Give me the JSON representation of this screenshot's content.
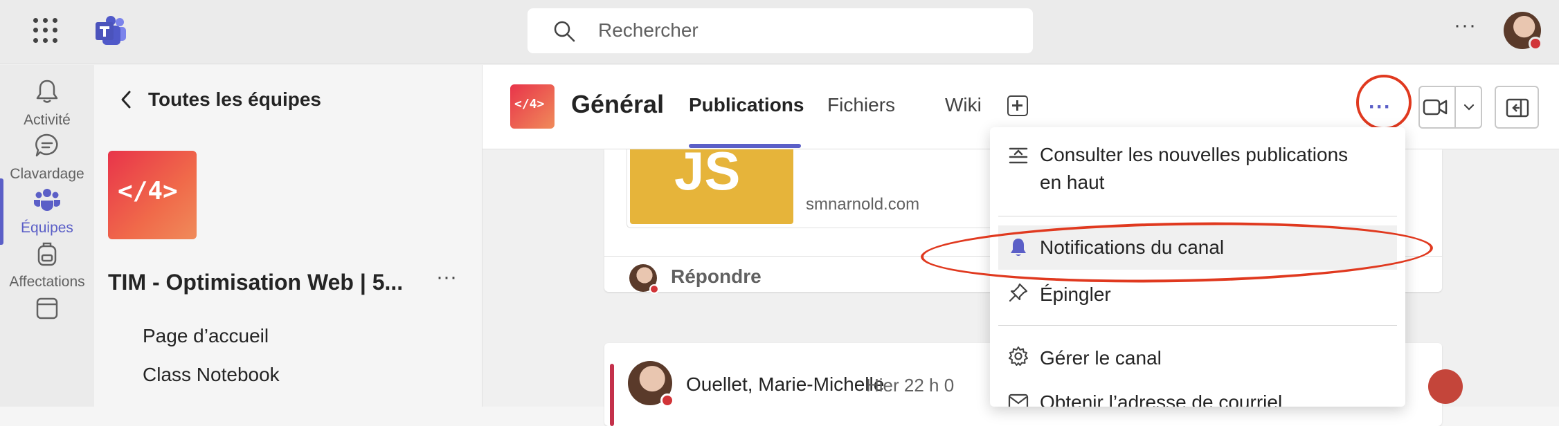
{
  "search": {
    "placeholder": "Rechercher"
  },
  "rail": {
    "items": [
      {
        "label": "Activité",
        "icon": "bell-icon"
      },
      {
        "label": "Clavardage",
        "icon": "chat-icon"
      },
      {
        "label": "Équipes",
        "icon": "teams-icon",
        "active": true
      },
      {
        "label": "Affectations",
        "icon": "backpack-icon"
      }
    ]
  },
  "sidebar": {
    "back_label": "Toutes les équipes",
    "team_tile_text": "</4>",
    "team_name": "TIM - Optimisation Web | 5...",
    "nav": [
      "Page d’accueil",
      "Class Notebook"
    ]
  },
  "channel": {
    "tile_text": "</4>",
    "title": "Général",
    "tabs": [
      "Publications",
      "Fichiers",
      "Wiki"
    ],
    "active_tab": "Publications"
  },
  "posts": {
    "link_thumb_text": "JS",
    "link_domain": "smnarnold.com",
    "reply_label": "Répondre",
    "author": "Ouellet, Marie-Michelle",
    "time": "Hier 22 h 0"
  },
  "menu": {
    "items": [
      {
        "label_line1": "Consulter les nouvelles publications",
        "label_line2": "en haut",
        "icon": "sort-new-top-icon"
      },
      {
        "label": "Notifications du canal",
        "icon": "bell-filled-icon",
        "highlighted": true
      },
      {
        "label": "Épingler",
        "icon": "pin-icon"
      },
      {
        "label": "Gérer le canal",
        "icon": "settings-icon"
      },
      {
        "label": "Obtenir l’adresse de courriel",
        "icon": "mail-icon"
      }
    ]
  },
  "colors": {
    "accent": "#5b5fc7",
    "annotation": "#e0391f",
    "presence_busy": "#d13438"
  }
}
